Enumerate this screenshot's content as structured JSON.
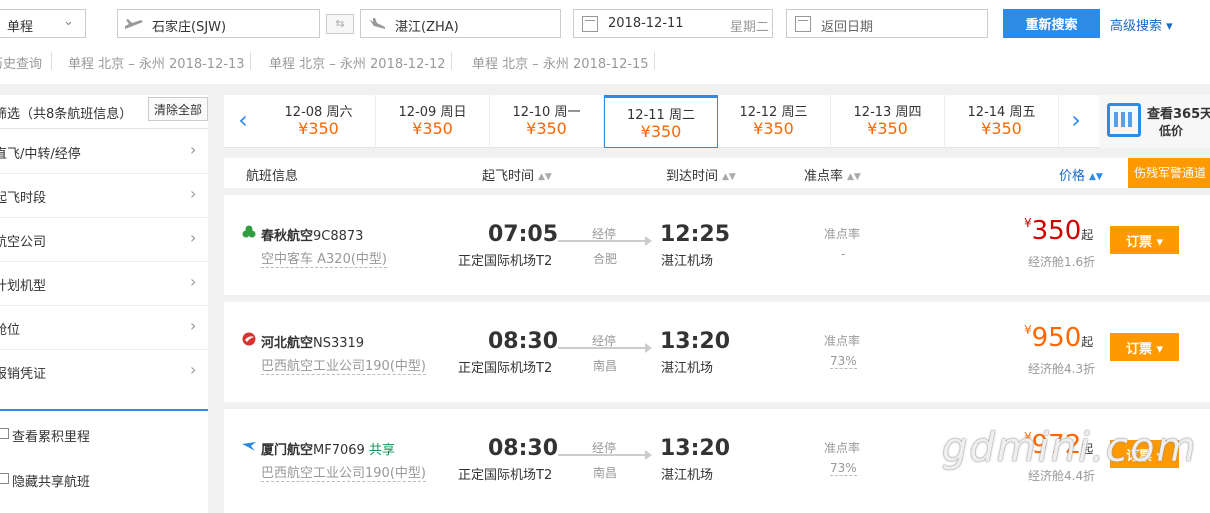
{
  "search": {
    "trip_type": "单程",
    "from": "石家庄(SJW)",
    "to": "湛江(ZHA)",
    "depart_date": "2018-12-11",
    "depart_weekday": "星期二",
    "return_placeholder": "返回日期",
    "search_label": "重新搜索",
    "advanced_label": "高级搜索 ▾",
    "history": [
      "历史查询",
      "单程 北京 – 永州 2018-12-13",
      "单程 北京 – 永州 2018-12-12",
      "单程 北京 – 永州 2018-12-15"
    ]
  },
  "sidebar": {
    "title": "筛选（共8条航班信息）",
    "clear_label": "清除全部",
    "filters": [
      "直飞/中转/经停",
      "起飞时段",
      "航空公司",
      "计划机型",
      "舱位",
      "报销凭证"
    ],
    "checkboxes": [
      "查看累积里程",
      "隐藏共享航班"
    ]
  },
  "dates": [
    {
      "date": "12-08 周六",
      "price": "350"
    },
    {
      "date": "12-09 周日",
      "price": "350"
    },
    {
      "date": "12-10 周一",
      "price": "350"
    },
    {
      "date": "12-11 周二",
      "price": "350"
    },
    {
      "date": "12-12 周三",
      "price": "350"
    },
    {
      "date": "12-13 周四",
      "price": "350"
    },
    {
      "date": "12-14 周五",
      "price": "350"
    }
  ],
  "currency": "¥",
  "calendar": {
    "line1": "查看365天",
    "line2": "低价"
  },
  "table_header": {
    "flight": "航班信息",
    "depart": "起飞时间",
    "arrive": "到达时间",
    "otp": "准点率",
    "price": "价格",
    "promo": "伤残军警通道"
  },
  "flights": [
    {
      "airline": "春秋航空",
      "no": "9C8873",
      "share": "",
      "plane": "空中客车 A320(中型)",
      "dep_time": "07:05",
      "dep_airport": "正定国际机场T2",
      "stop_label": "经停",
      "stop_city": "合肥",
      "arr_time": "12:25",
      "arr_airport": "湛江机场",
      "otp_label": "准点率",
      "otp": "-",
      "price": "350",
      "qi": "起",
      "cabin": "经济舱1.6折",
      "book": "订票"
    },
    {
      "airline": "河北航空",
      "no": "NS3319",
      "share": "",
      "plane": "巴西航空工业公司190(中型)",
      "dep_time": "08:30",
      "dep_airport": "正定国际机场T2",
      "stop_label": "经停",
      "stop_city": "南昌",
      "arr_time": "13:20",
      "arr_airport": "湛江机场",
      "otp_label": "准点率",
      "otp": "73%",
      "price": "950",
      "qi": "起",
      "cabin": "经济舱4.3折",
      "book": "订票"
    },
    {
      "airline": "厦门航空",
      "no": "MF7069",
      "share": "共享",
      "plane": "巴西航空工业公司190(中型)",
      "dep_time": "08:30",
      "dep_airport": "正定国际机场T2",
      "stop_label": "经停",
      "stop_city": "南昌",
      "arr_time": "13:20",
      "arr_airport": "湛江机场",
      "otp_label": "准点率",
      "otp": "73%",
      "price": "972",
      "qi": "起",
      "cabin": "经济舱4.4折",
      "book": "订票"
    }
  ],
  "watermark": "gdmini.com",
  "colors": {
    "accent": "#2d8ae6",
    "price": "#ff6600",
    "price_low": "#cc0000",
    "book": "#ff9900"
  }
}
